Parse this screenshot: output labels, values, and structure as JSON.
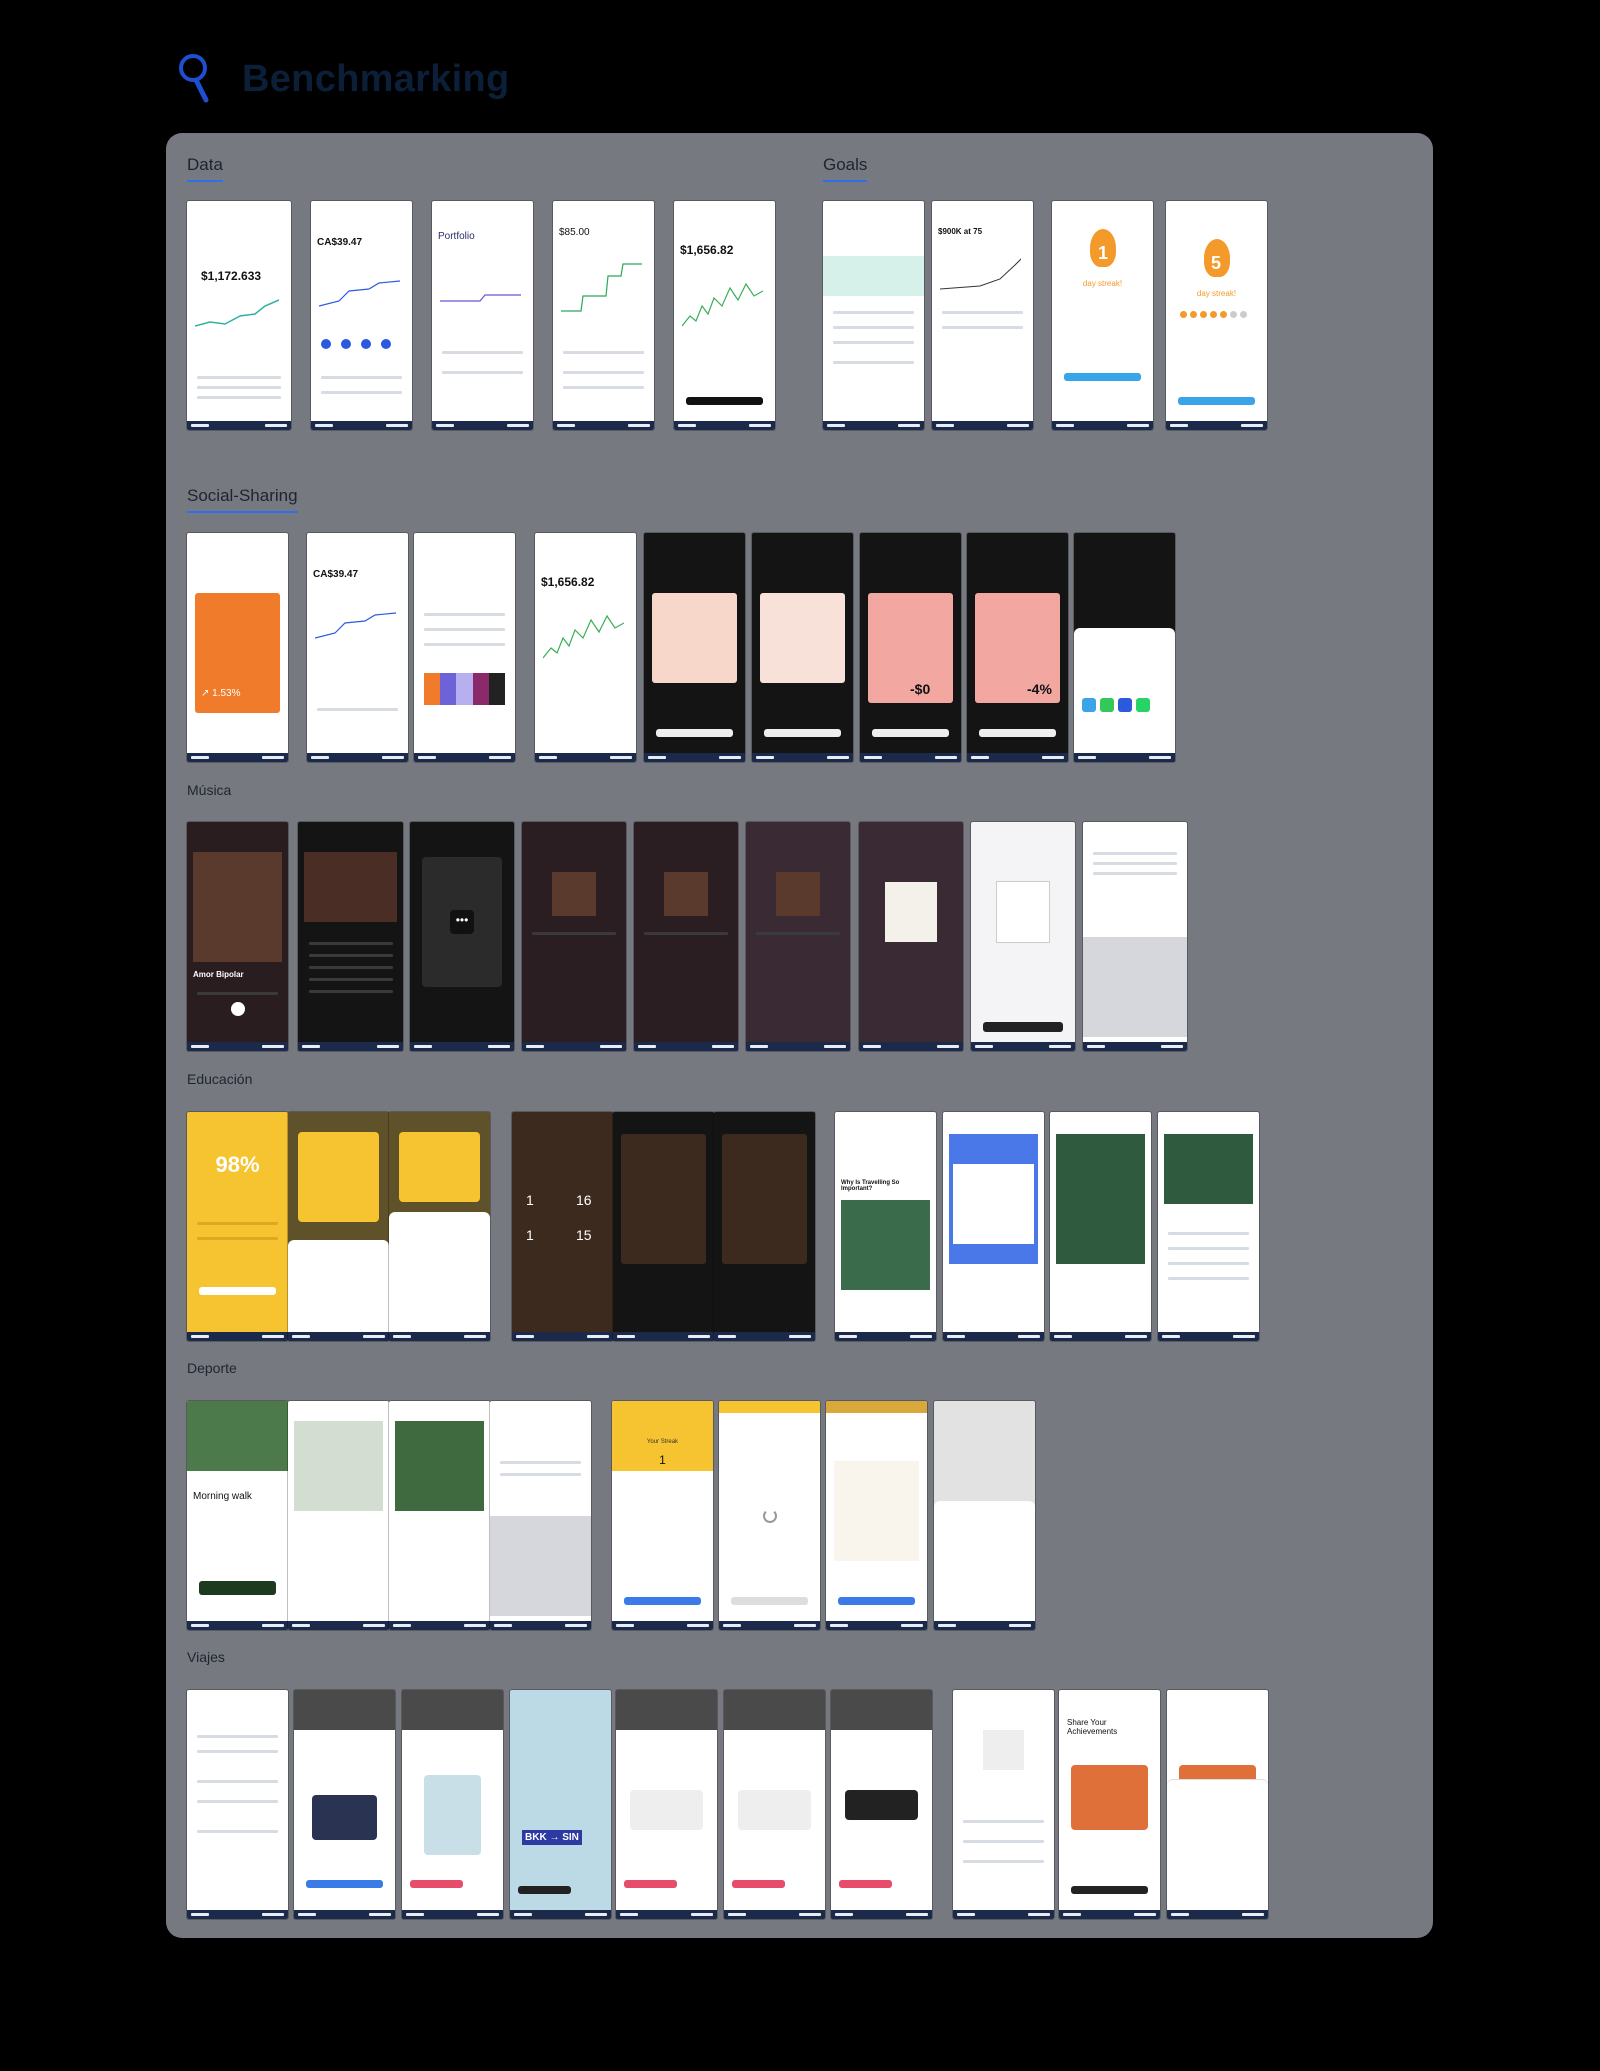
{
  "header": {
    "title": "Benchmarking",
    "icon": "magnifier-icon"
  },
  "sections": {
    "data": "Data",
    "goals": "Goals",
    "social": "Social-Sharing",
    "musica": "Música",
    "educacion": "Educación",
    "deporte": "Deporte",
    "viajes": "Viajes"
  },
  "screens": {
    "data_1_amount": "$1,172.633",
    "data_2_amount": "CA$39.47",
    "data_3_title": "Portfolio",
    "data_4_amount": "$85.00",
    "data_5_amount": "$1,656.82",
    "goals_2_title": "$900K at 75",
    "goals_3_streak": "1",
    "goals_3_label": "day streak!",
    "goals_4_streak": "5",
    "goals_4_label": "day streak!",
    "social_1_pct": "↗ 1.53%",
    "social_2_amount": "CA$39.47",
    "social_4_amount": "$1,656.82",
    "social_7_value": "-$0",
    "social_8_value": "-4%",
    "musica_1_song": "Amor Bipolar",
    "educacion_1_pct": "98%",
    "educacion_5_title": "Why Is Travelling So Important?",
    "deporte_1_title": "Morning walk",
    "deporte_5_label": "Your Streak",
    "deporte_5_value": "1",
    "viajes_4_route": "BKK → SIN",
    "viajes_9_title": "Share Your Achievements"
  }
}
